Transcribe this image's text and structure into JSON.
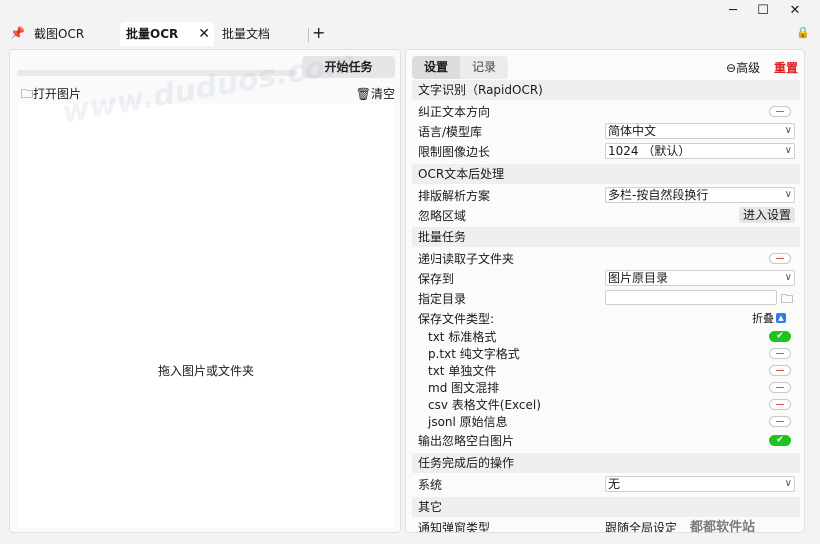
{
  "window": {
    "minimize": "─",
    "maximize": "☐",
    "close": "✕"
  },
  "tabs": [
    {
      "label": "截图OCR",
      "active": false
    },
    {
      "label": "批量OCR",
      "active": true
    },
    {
      "label": "批量文档",
      "active": false
    }
  ],
  "tab_add": "+",
  "tab_close": "✕",
  "left": {
    "start_button": "开始任务",
    "open_images": "打开图片",
    "clear": "清空",
    "drop_hint": "拖入图片或文件夹"
  },
  "right": {
    "tab_settings": "设置",
    "tab_records": "记录",
    "advanced": "高级",
    "reset": "重置",
    "sections": {
      "ocr": "文字识别（RapidOCR)",
      "post": "OCR文本后处理",
      "batch": "批量任务",
      "done": "任务完成后的操作",
      "other": "其它"
    },
    "rows": {
      "correct_dir": "纠正文本方向",
      "language": "语言/模型库",
      "language_value": "简体中文",
      "limit_edge": "限制图像边长",
      "limit_edge_value": "1024 （默认）",
      "layout": "排版解析方案",
      "layout_value": "多栏-按自然段换行",
      "ignore_area": "忽略区域",
      "enter_settings": "进入设置",
      "recursive": "递归读取子文件夹",
      "save_to": "保存到",
      "save_to_value": "图片原目录",
      "target_dir": "指定目录",
      "file_types": "保存文件类型:",
      "fold": "折叠",
      "types": [
        {
          "label": "txt 标准格式",
          "on": true
        },
        {
          "label": "p.txt 纯文字格式",
          "on": false
        },
        {
          "label": "txt 单独文件",
          "on": false
        },
        {
          "label": "md 图文混排",
          "on": false
        },
        {
          "label": "csv 表格文件(Excel)",
          "on": false
        },
        {
          "label": "jsonl 原始信息",
          "on": false
        }
      ],
      "output_blank": "输出忽略空白图片",
      "system": "系统",
      "system_value": "无",
      "notify_cut": "通知弹窗类型",
      "notify_cut_value": "跟随全局设定"
    }
  },
  "watermark": "都都软件站",
  "watermark_top": "www.duduos.com",
  "colors": {
    "reset": "#e02020",
    "toggle_on": "#1fc41f",
    "accent": "#2b7de9"
  },
  "icons": [
    "pin-icon",
    "lock-icon",
    "folder-icon",
    "trash-icon",
    "minus-circle-icon",
    "chevron-down-icon",
    "check-icon",
    "collapse-icon"
  ]
}
